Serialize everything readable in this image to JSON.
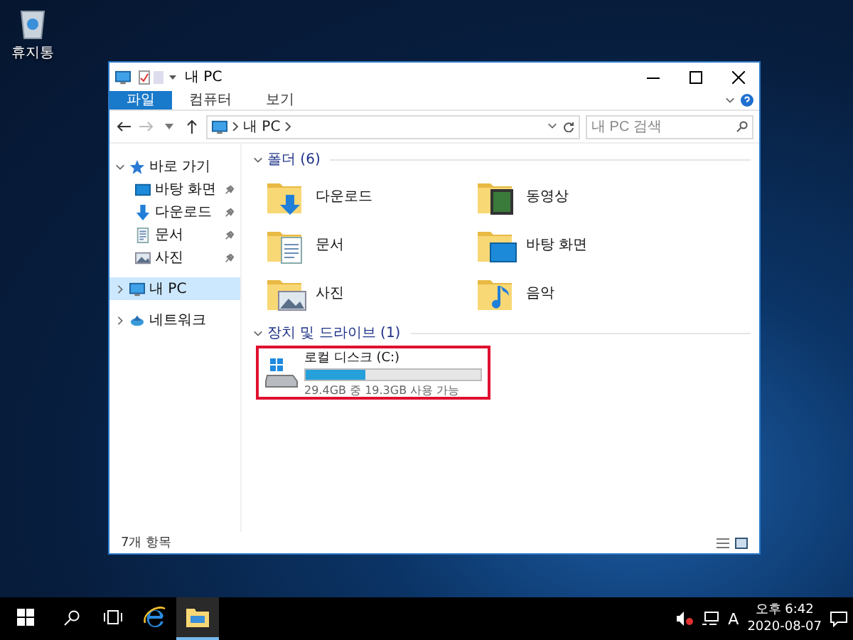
{
  "desktop_icons": [
    {
      "label": "휴지통"
    }
  ],
  "window": {
    "title": "내 PC",
    "ribbon_tabs": [
      {
        "label": "파일",
        "selected": true
      },
      {
        "label": "컴퓨터",
        "selected": false
      },
      {
        "label": "보기",
        "selected": false
      }
    ],
    "address": {
      "path": "내 PC"
    },
    "search": {
      "placeholder": "내 PC 검색"
    },
    "sidebar": [
      {
        "label": "바로 가기",
        "kind": "star",
        "selected": false,
        "expanded": true,
        "children": [
          {
            "label": "바탕 화면",
            "kind": "desktop",
            "selected": false,
            "pinned": true
          },
          {
            "label": "다운로드",
            "kind": "download",
            "selected": false,
            "pinned": true
          },
          {
            "label": "문서",
            "kind": "documents",
            "selected": false,
            "pinned": true
          },
          {
            "label": "사진",
            "kind": "pictures",
            "selected": false,
            "pinned": true
          }
        ]
      },
      {
        "label": "내 PC",
        "kind": "pc",
        "selected": true,
        "expanded": false
      },
      {
        "label": "네트워크",
        "kind": "network",
        "selected": false,
        "expanded": false
      }
    ],
    "folders": {
      "title": "폴더 (6)",
      "expanded": true,
      "items": [
        {
          "label": "다운로드",
          "kind": "download"
        },
        {
          "label": "동영상",
          "kind": "videos"
        },
        {
          "label": "문서",
          "kind": "documents"
        },
        {
          "label": "바탕 화면",
          "kind": "desktop"
        },
        {
          "label": "사진",
          "kind": "pictures"
        },
        {
          "label": "음악",
          "kind": "music"
        }
      ]
    },
    "drives": {
      "title": "장치 및 드라이브 (1)",
      "expanded": true,
      "items": [
        {
          "name": "로컬 디스크 (C:)",
          "level": 0.34,
          "reading": "29.4GB 중 19.3GB 사용 가능",
          "highlighted": true
        }
      ]
    },
    "status_bar": {
      "count": "7개 항목"
    }
  },
  "taskbar": {
    "apps": [
      {
        "kind": "browser",
        "selected": false
      },
      {
        "kind": "explorer",
        "selected": true
      }
    ],
    "ime": "A",
    "time": "오후 6:42",
    "date": "2020-08-07"
  }
}
